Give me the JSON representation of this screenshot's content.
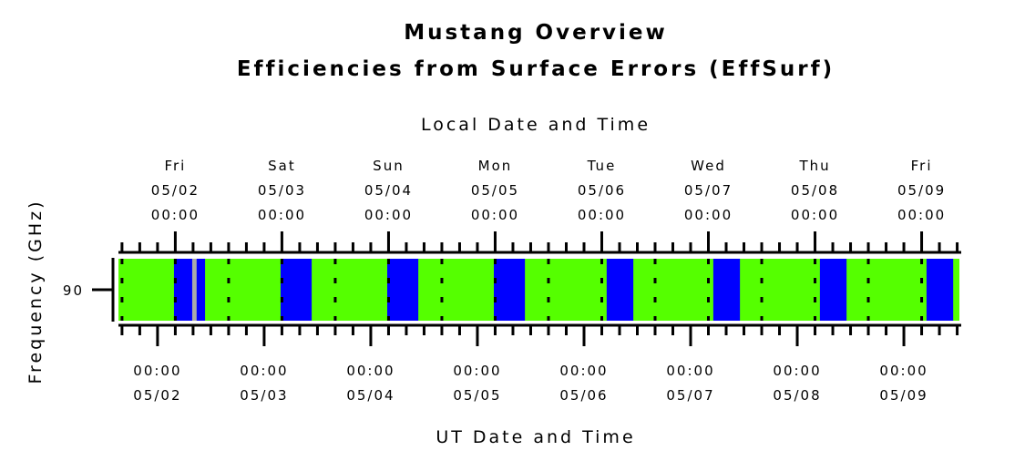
{
  "chart_data": {
    "type": "timeline",
    "title": "Mustang Overview",
    "subtitle": "Efficiencies from Surface Errors (EffSurf)",
    "top_axis_label": "Local Date and Time",
    "bottom_axis_label": "UT Date and Time",
    "ylabel": "Frequency (GHz)",
    "y_categories": [
      "90"
    ],
    "local_offset_hours": -4,
    "x_range_ut": [
      "05/01 15:12",
      "05/09 12:30"
    ],
    "grid": "dotted every 12 hours local",
    "colors": {
      "good": "#55ff00",
      "poor": "#0000ff",
      "nodata": "#aaaaaa"
    },
    "top_ticks": [
      {
        "day": "Fri",
        "date": "05/02",
        "time": "00:00"
      },
      {
        "day": "Sat",
        "date": "05/03",
        "time": "00:00"
      },
      {
        "day": "Sun",
        "date": "05/04",
        "time": "00:00"
      },
      {
        "day": "Mon",
        "date": "05/05",
        "time": "00:00"
      },
      {
        "day": "Tue",
        "date": "05/06",
        "time": "00:00"
      },
      {
        "day": "Wed",
        "date": "05/07",
        "time": "00:00"
      },
      {
        "day": "Thu",
        "date": "05/08",
        "time": "00:00"
      },
      {
        "day": "Fri",
        "date": "05/09",
        "time": "00:00"
      }
    ],
    "bottom_ticks": [
      {
        "time": "00:00",
        "date": "05/02"
      },
      {
        "time": "00:00",
        "date": "05/03"
      },
      {
        "time": "00:00",
        "date": "05/04"
      },
      {
        "time": "00:00",
        "date": "05/05"
      },
      {
        "time": "00:00",
        "date": "05/06"
      },
      {
        "time": "00:00",
        "date": "05/07"
      },
      {
        "time": "00:00",
        "date": "05/08"
      },
      {
        "time": "00:00",
        "date": "05/09"
      }
    ],
    "segments_ut": [
      {
        "start": "05/02 03:42",
        "end": "05/02 10:42",
        "status": "poor"
      },
      {
        "start": "05/02 07:48",
        "end": "05/02 08:48",
        "status": "nodata"
      },
      {
        "start": "05/03 03:42",
        "end": "05/03 10:42",
        "status": "poor"
      },
      {
        "start": "05/04 03:42",
        "end": "05/04 10:42",
        "status": "poor"
      },
      {
        "start": "05/05 03:42",
        "end": "05/05 10:42",
        "status": "poor"
      },
      {
        "start": "05/06 05:06",
        "end": "05/06 11:06",
        "status": "poor"
      },
      {
        "start": "05/07 05:06",
        "end": "05/07 11:06",
        "status": "poor"
      },
      {
        "start": "05/08 05:06",
        "end": "05/08 11:06",
        "status": "poor"
      },
      {
        "start": "05/09 05:06",
        "end": "05/09 11:06",
        "status": "poor"
      }
    ],
    "background_status": "good"
  }
}
